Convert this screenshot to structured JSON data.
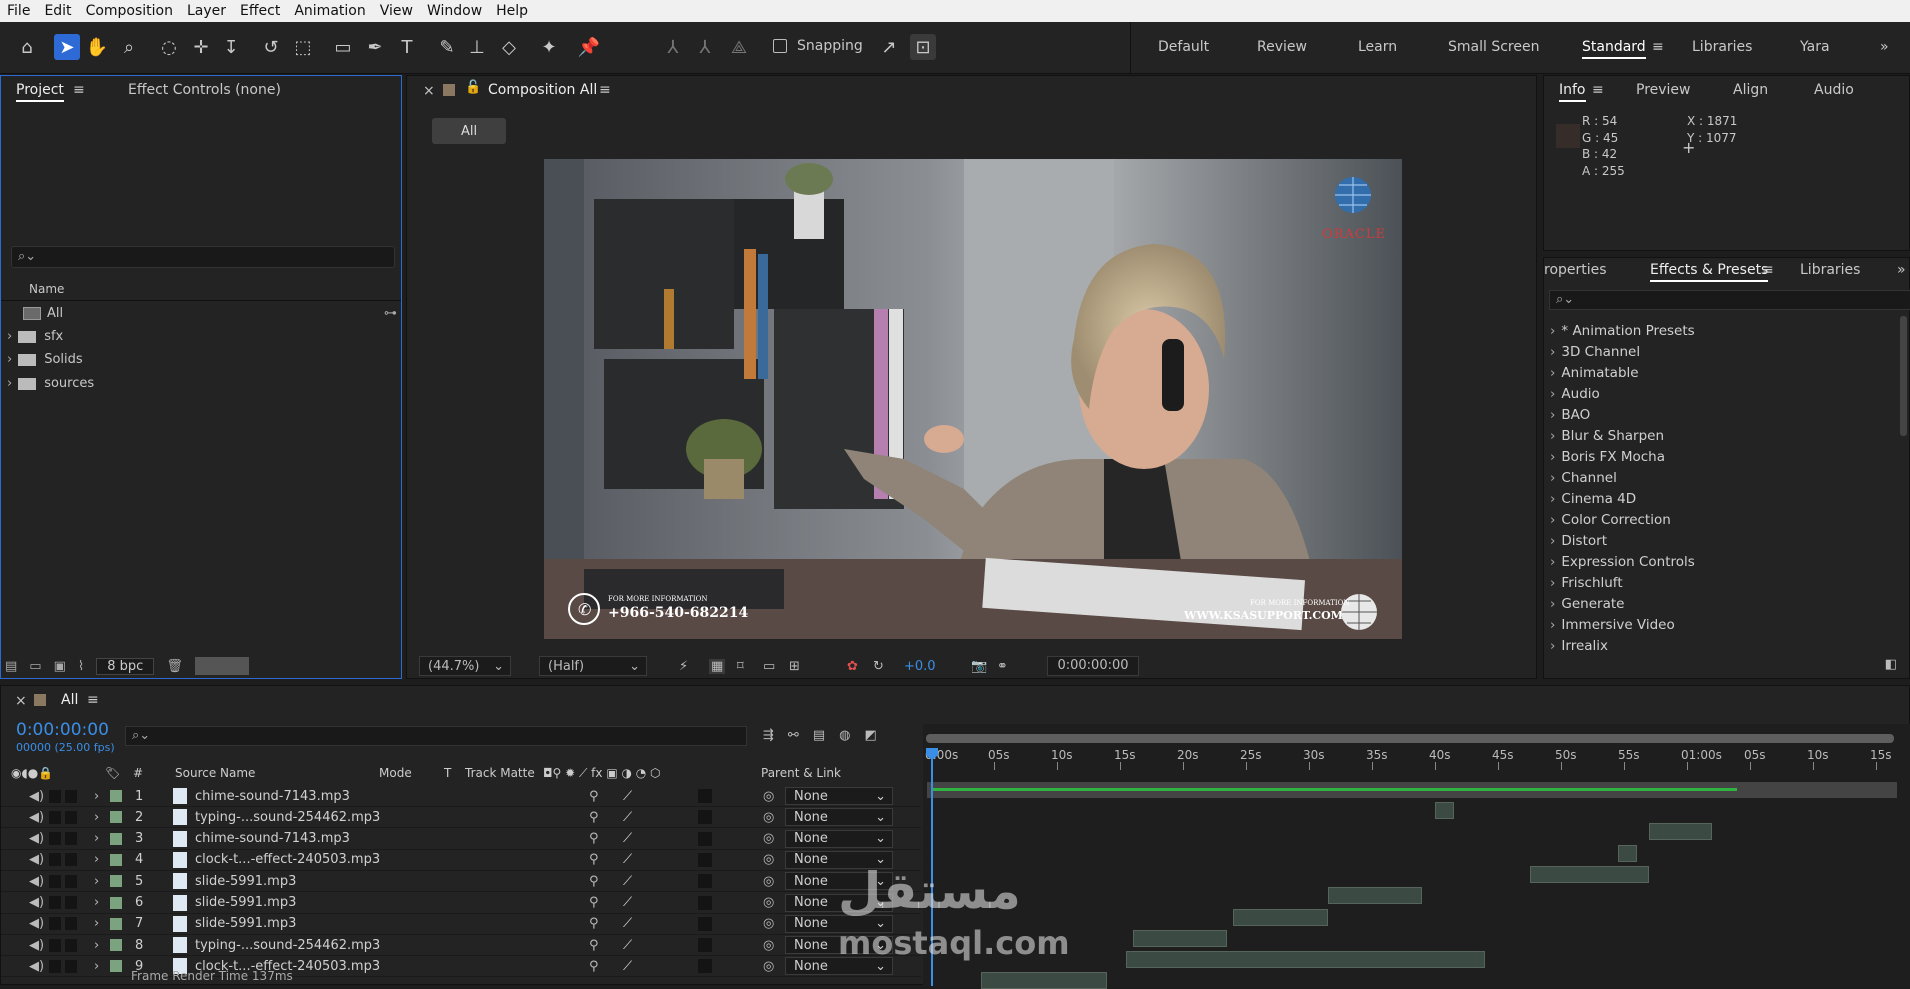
{
  "menu": [
    "File",
    "Edit",
    "Composition",
    "Layer",
    "Effect",
    "Animation",
    "View",
    "Window",
    "Help"
  ],
  "toolbar": {
    "snapping_label": "Snapping"
  },
  "workspaces": [
    "Default",
    "Review",
    "Learn",
    "Small Screen",
    "Standard",
    "Libraries",
    "Yara"
  ],
  "project_panel": {
    "tab_project": "Project",
    "tab_effect_controls": "Effect Controls (none)",
    "column_name": "Name",
    "items": [
      "All",
      "sfx",
      "Solids",
      "sources"
    ],
    "bpc": "8 bpc"
  },
  "comp_panel": {
    "title": "Composition All",
    "comp_button": "All",
    "zoom": "(44.7%)",
    "resolution": "(Half)",
    "exposure": "+0.0",
    "timecode": "0:00:00:00",
    "video": {
      "logo_text": "ORACLE",
      "more_info_left": "FOR MORE INFORMATION",
      "phone": "+966-540-682214",
      "more_info_right": "FOR MORE INFORMATION",
      "website": "WWW.KSASUPPORT.COM"
    }
  },
  "info_panel": {
    "tabs": [
      "Info",
      "Preview",
      "Align",
      "Audio"
    ],
    "r": "R : 54",
    "g": "G : 45",
    "b": "B : 42",
    "a": "A : 255",
    "x": "X : 1871",
    "y": "Y : 1077",
    "swatch_color": "#362d2a"
  },
  "effects_panel": {
    "tabs": [
      "roperties",
      "Effects & Presets",
      "Libraries"
    ],
    "items": [
      "* Animation Presets",
      "3D Channel",
      "Animatable",
      "Audio",
      "BAO",
      "Blur & Sharpen",
      "Boris FX Mocha",
      "Channel",
      "Cinema 4D",
      "Color Correction",
      "Distort",
      "Expression Controls",
      "Frischluft",
      "Generate",
      "Immersive Video",
      "Irrealix"
    ]
  },
  "timeline": {
    "comp_name": "All",
    "timecode": "0:00:00:00",
    "fps": "00000 (25.00 fps)",
    "columns": {
      "num": "#",
      "source": "Source Name",
      "mode": "Mode",
      "t": "T",
      "matte": "Track Matte",
      "parent": "Parent & Link"
    },
    "ruler": [
      "0:00s",
      "05s",
      "10s",
      "15s",
      "20s",
      "25s",
      "30s",
      "35s",
      "40s",
      "45s",
      "50s",
      "55s",
      "01:00s",
      "05s",
      "10s",
      "15s"
    ],
    "layers": [
      {
        "num": "1",
        "name": "chime-sound-7143.mp3",
        "parent": "None",
        "start": 40.0,
        "end": 41.5
      },
      {
        "num": "2",
        "name": "typing-...sound-254462.mp3",
        "parent": "None",
        "start": 57.0,
        "end": 62.0
      },
      {
        "num": "3",
        "name": "chime-sound-7143.mp3",
        "parent": "None",
        "start": 54.5,
        "end": 56.0
      },
      {
        "num": "4",
        "name": "clock-t...-effect-240503.mp3",
        "parent": "None",
        "start": 47.5,
        "end": 57.0
      },
      {
        "num": "5",
        "name": "slide-5991.mp3",
        "parent": "None",
        "start": 31.5,
        "end": 39.0
      },
      {
        "num": "6",
        "name": "slide-5991.mp3",
        "parent": "None",
        "start": 24.0,
        "end": 31.5
      },
      {
        "num": "7",
        "name": "slide-5991.mp3",
        "parent": "None",
        "start": 16.0,
        "end": 23.5
      },
      {
        "num": "8",
        "name": "typing-...sound-254462.mp3",
        "parent": "None",
        "start": 15.5,
        "end": 44.0
      },
      {
        "num": "9",
        "name": "clock-t...-effect-240503.mp3",
        "parent": "None",
        "start": 4.0,
        "end": 14.0
      }
    ],
    "work_area_end": 64.0,
    "footer": "Frame Render Time  137ms"
  },
  "watermark": {
    "arabic": "مستقل",
    "latin": "mostaql.com"
  }
}
